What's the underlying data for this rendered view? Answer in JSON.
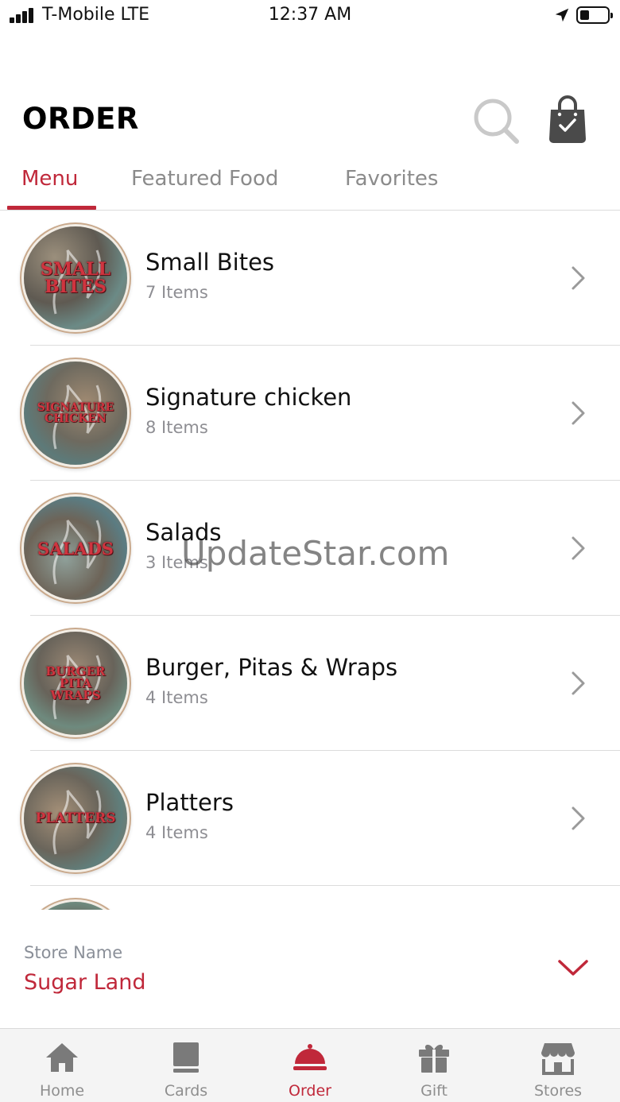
{
  "status_bar": {
    "carrier": "T-Mobile LTE",
    "time": "12:37 AM",
    "battery_level": 0.35
  },
  "header": {
    "title": "ORDER",
    "search_icon": "search-icon",
    "bag_icon": "shopping-bag-check-icon"
  },
  "tabs": [
    {
      "label": "Menu",
      "active": true
    },
    {
      "label": "Featured Food",
      "active": false
    },
    {
      "label": "Favorites",
      "active": false
    }
  ],
  "menu": {
    "items": [
      {
        "title": "Small Bites",
        "count": "7 Items",
        "thumb_text": "SMALL\nBITES"
      },
      {
        "title": "Signature chicken",
        "count": "8 Items",
        "thumb_text": "SIGNATURE\nCHICKEN"
      },
      {
        "title": "Salads",
        "count": "3 Items",
        "thumb_text": "SALADS"
      },
      {
        "title": "Burger, Pitas & Wraps",
        "count": "4 Items",
        "thumb_text": "BURGER\nPITA\nWRAPS"
      },
      {
        "title": "Platters",
        "count": "4 Items",
        "thumb_text": "PLATTERS"
      }
    ]
  },
  "watermark": "UpdateStar.com",
  "store": {
    "label": "Store Name",
    "value": "Sugar Land"
  },
  "nav": [
    {
      "label": "Home",
      "icon": "home-icon",
      "active": false
    },
    {
      "label": "Cards",
      "icon": "card-icon",
      "active": false
    },
    {
      "label": "Order",
      "icon": "cloche-icon",
      "active": true
    },
    {
      "label": "Gift",
      "icon": "gift-icon",
      "active": false
    },
    {
      "label": "Stores",
      "icon": "storefront-icon",
      "active": false
    }
  ],
  "colors": {
    "accent": "#c0283a",
    "inactive": "#8e8e8e",
    "icon_gray": "#7a7a7a"
  }
}
